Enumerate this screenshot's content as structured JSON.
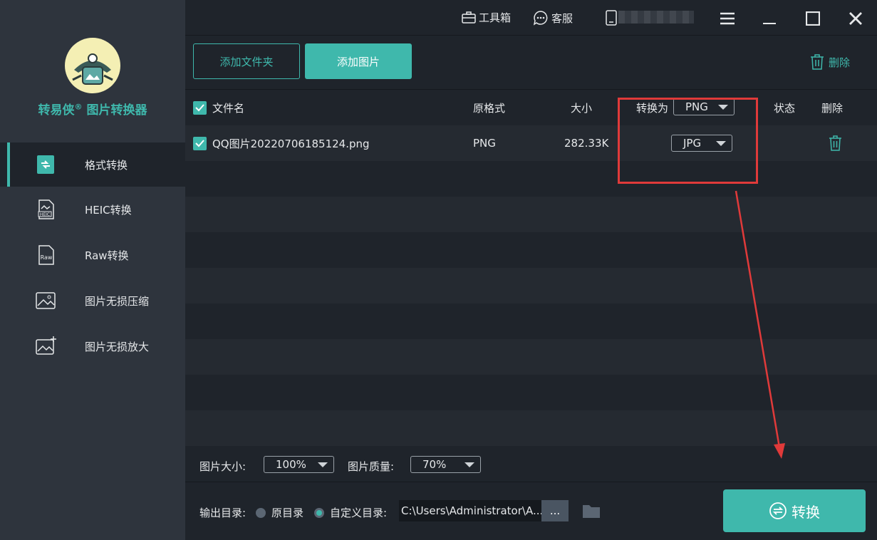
{
  "brand": {
    "name": "转易侠",
    "reg": "®",
    "suffix": " 图片转换器"
  },
  "sidebar": {
    "items": [
      {
        "label": "格式转换",
        "icon": "format-convert-icon"
      },
      {
        "label": "HEIC转换",
        "icon": "heic-file-icon"
      },
      {
        "label": "Raw转换",
        "icon": "raw-file-icon"
      },
      {
        "label": "图片无损压缩",
        "icon": "image-compress-icon"
      },
      {
        "label": "图片无损放大",
        "icon": "image-enlarge-icon"
      }
    ]
  },
  "topbar": {
    "toolbox": "工具箱",
    "service": "客服"
  },
  "toolbar": {
    "add_folder": "添加文件夹",
    "add_image": "添加图片",
    "delete": "删除"
  },
  "table": {
    "headers": {
      "filename": "文件名",
      "orig_format": "原格式",
      "size": "大小",
      "convert_to": "转换为",
      "status": "状态",
      "delete": "删除"
    },
    "global_target": "PNG",
    "rows": [
      {
        "filename": "QQ图片20220706185124.png",
        "orig_format": "PNG",
        "size": "282.33K",
        "target": "JPG",
        "status": ""
      }
    ]
  },
  "options": {
    "size_label": "图片大小:",
    "size_value": "100%",
    "quality_label": "图片质量:",
    "quality_value": "70%"
  },
  "output": {
    "label": "输出目录:",
    "original": "原目录",
    "custom": "自定义目录:",
    "path": "C:\\Users\\Administrator\\A...",
    "browse": "...",
    "convert": "转换"
  },
  "colors": {
    "accent": "#3fb8ac",
    "annotation": "#e03a3a"
  }
}
